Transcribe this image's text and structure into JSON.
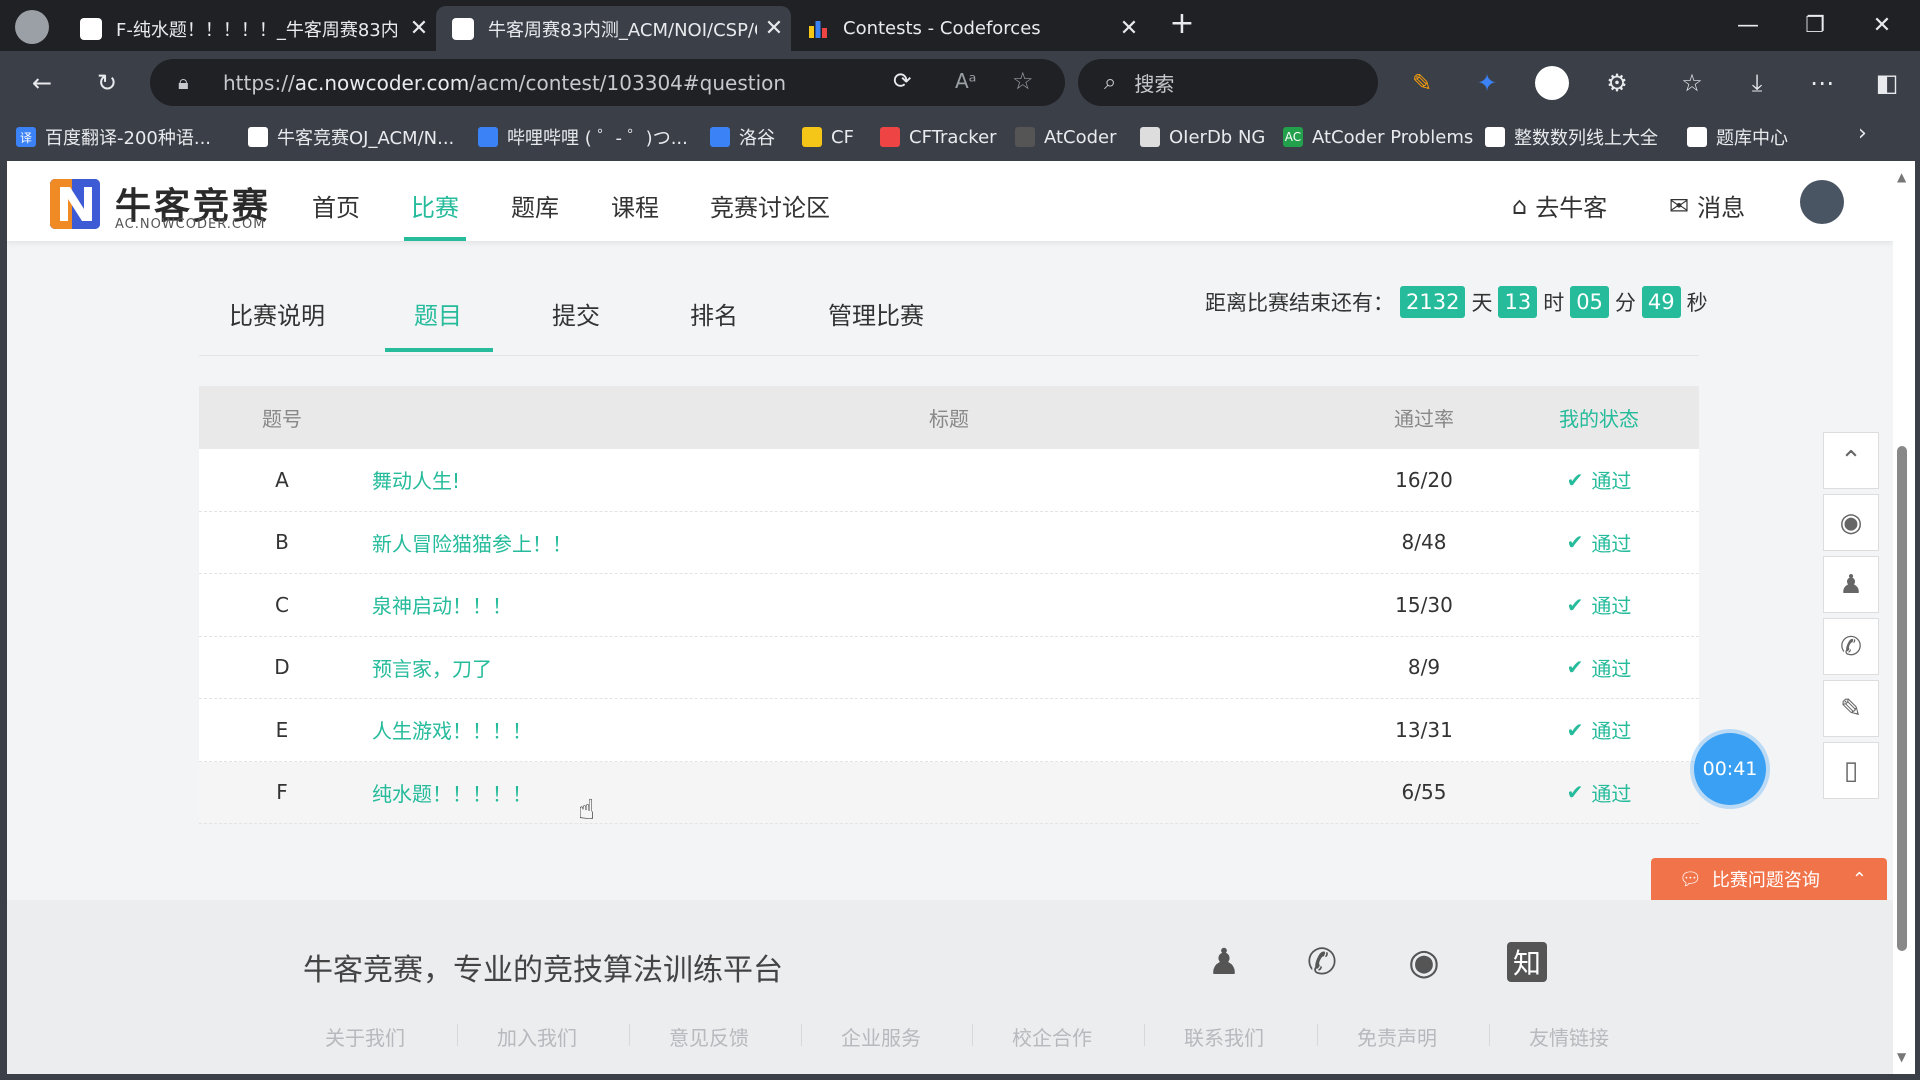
{
  "browser": {
    "tabs": [
      {
        "title": "F-纯水题！！！！！_牛客周赛83内",
        "active": false
      },
      {
        "title": "牛客周赛83内测_ACM/NOI/CSP/C",
        "active": true
      },
      {
        "title": "Contests - Codeforces",
        "active": false
      }
    ],
    "url_prefix": "https://",
    "url_host": "ac.nowcoder.com",
    "url_path": "/acm/contest/103304#question",
    "search_placeholder": "搜索",
    "bookmarks": [
      {
        "label": "百度翻译-200种语...",
        "icon": "translate-icon",
        "color": "#3b82f6",
        "glyph": "译"
      },
      {
        "label": "牛客竞赛OJ_ACM/N...",
        "icon": "nowcoder-icon",
        "color": "#ffffff",
        "glyph": ""
      },
      {
        "label": "哔哩哔哩 ( ゜- ゜)つ...",
        "icon": "bilibili-icon",
        "color": "#3b82f6",
        "glyph": ""
      },
      {
        "label": "洛谷",
        "icon": "luogu-icon",
        "color": "#3b82f6",
        "glyph": ""
      },
      {
        "label": "CF",
        "icon": "codeforces-icon",
        "color": "#f5c518",
        "glyph": ""
      },
      {
        "label": "CFTracker",
        "icon": "cftracker-icon",
        "color": "#ef4444",
        "glyph": ""
      },
      {
        "label": "AtCoder",
        "icon": "atcoder-icon",
        "color": "#555555",
        "glyph": ""
      },
      {
        "label": "OIerDb NG",
        "icon": "oierdb-icon",
        "color": "#dddddd",
        "glyph": ""
      },
      {
        "label": "AtCoder Problems",
        "icon": "atcoder-problems-icon",
        "color": "#22a04b",
        "glyph": "AC"
      },
      {
        "label": "整数数列线上大全",
        "icon": "oeis-icon",
        "color": "#ffffff",
        "glyph": ""
      },
      {
        "label": "题库中心",
        "icon": "problem-bank-icon",
        "color": "#ffffff",
        "glyph": ""
      }
    ]
  },
  "site": {
    "logo_text": "牛客竞赛",
    "logo_sub": "AC.NOWCODER.COM",
    "nav": [
      "首页",
      "比赛",
      "题库",
      "课程",
      "竞赛讨论区"
    ],
    "nav_active": "比赛",
    "go_nowcoder": "去牛客",
    "messages": "消息"
  },
  "contest": {
    "tabs": [
      "比赛说明",
      "题目",
      "提交",
      "排名",
      "管理比赛"
    ],
    "active_tab": "题目",
    "countdown_label": "距离比赛结束还有：",
    "days": "2132",
    "days_unit": "天",
    "hours": "13",
    "hours_unit": "时",
    "minutes": "05",
    "minutes_unit": "分",
    "seconds": "49",
    "seconds_unit": "秒"
  },
  "table": {
    "headers": {
      "id": "题号",
      "title": "标题",
      "rate": "通过率",
      "status": "我的状态"
    },
    "rows": [
      {
        "id": "A",
        "title": "舞动人生!",
        "rate": "16/20",
        "status": "通过"
      },
      {
        "id": "B",
        "title": "新人冒险猫猫参上！！",
        "rate": "8/48",
        "status": "通过"
      },
      {
        "id": "C",
        "title": "泉神启动！！！",
        "rate": "15/30",
        "status": "通过"
      },
      {
        "id": "D",
        "title": "预言家，刀了",
        "rate": "8/9",
        "status": "通过"
      },
      {
        "id": "E",
        "title": "人生游戏！！！！",
        "rate": "13/31",
        "status": "通过"
      },
      {
        "id": "F",
        "title": "纯水题！！！！！",
        "rate": "6/55",
        "status": "通过"
      }
    ]
  },
  "widgets": {
    "timer": "00:41",
    "consult": "比赛问题咨询"
  },
  "footer": {
    "slogan": "牛客竞赛，专业的竞技算法训练平台",
    "zhihu_glyph": "知",
    "links": [
      "关于我们",
      "加入我们",
      "意见反馈",
      "企业服务",
      "校企合作",
      "联系我们",
      "免责声明",
      "友情链接"
    ]
  },
  "colors": {
    "accent": "#25bb9b",
    "consult": "#f0734a",
    "timer": "#3aa0f3"
  }
}
